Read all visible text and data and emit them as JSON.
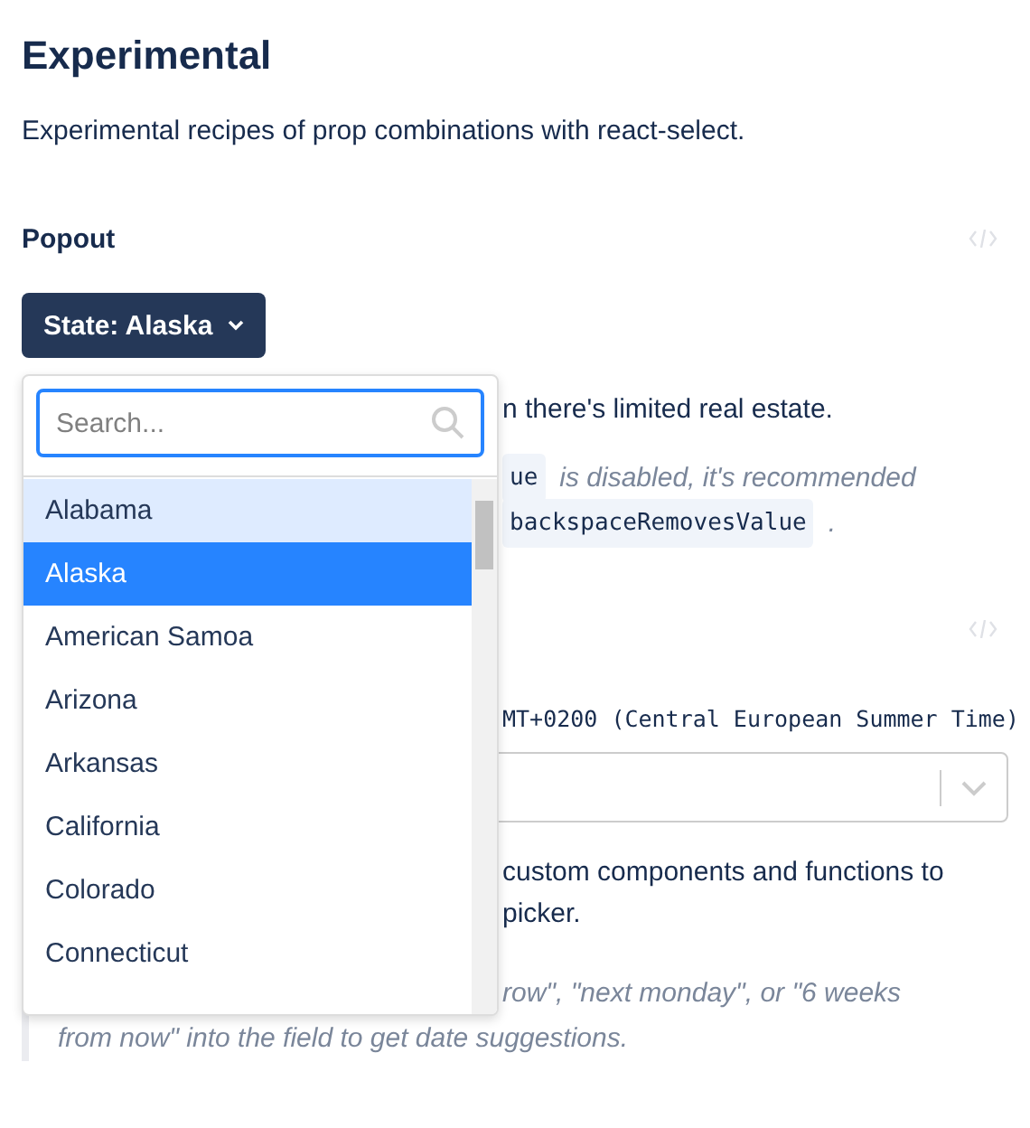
{
  "title": "Experimental",
  "intro": "Experimental recipes of prop combinations with react-select.",
  "popout_section": {
    "heading": "Popout",
    "button_label": "State: Alaska",
    "paragraph": "n there's limited real estate.",
    "note_lines": [
      [
        {
          "kind": "code",
          "text": "ue"
        },
        {
          "kind": "italic",
          "text": "is disabled, it's recommended"
        }
      ],
      [
        {
          "kind": "code",
          "text": "backspaceRemovesValue"
        },
        {
          "kind": "italic",
          "text": "."
        }
      ]
    ],
    "dropdown": {
      "search": {
        "placeholder": "Search..."
      },
      "options": [
        {
          "label": "Alabama",
          "focused": true,
          "selected": false
        },
        {
          "label": "Alaska",
          "focused": false,
          "selected": true
        },
        {
          "label": "American Samoa",
          "focused": false,
          "selected": false
        },
        {
          "label": "Arizona",
          "focused": false,
          "selected": false
        },
        {
          "label": "Arkansas",
          "focused": false,
          "selected": false
        },
        {
          "label": "California",
          "focused": false,
          "selected": false
        },
        {
          "label": "Colorado",
          "focused": false,
          "selected": false
        },
        {
          "label": "Connecticut",
          "focused": false,
          "selected": false
        }
      ]
    }
  },
  "date_section": {
    "date_value": "MT+0200 (Central European Summer Time)",
    "paragraph_lines": [
      "custom components and functions to",
      "picker."
    ],
    "note_lines": [
      "row\", \"next monday\", or \"6 weeks",
      "from now\" into the field to get date suggestions."
    ]
  }
}
